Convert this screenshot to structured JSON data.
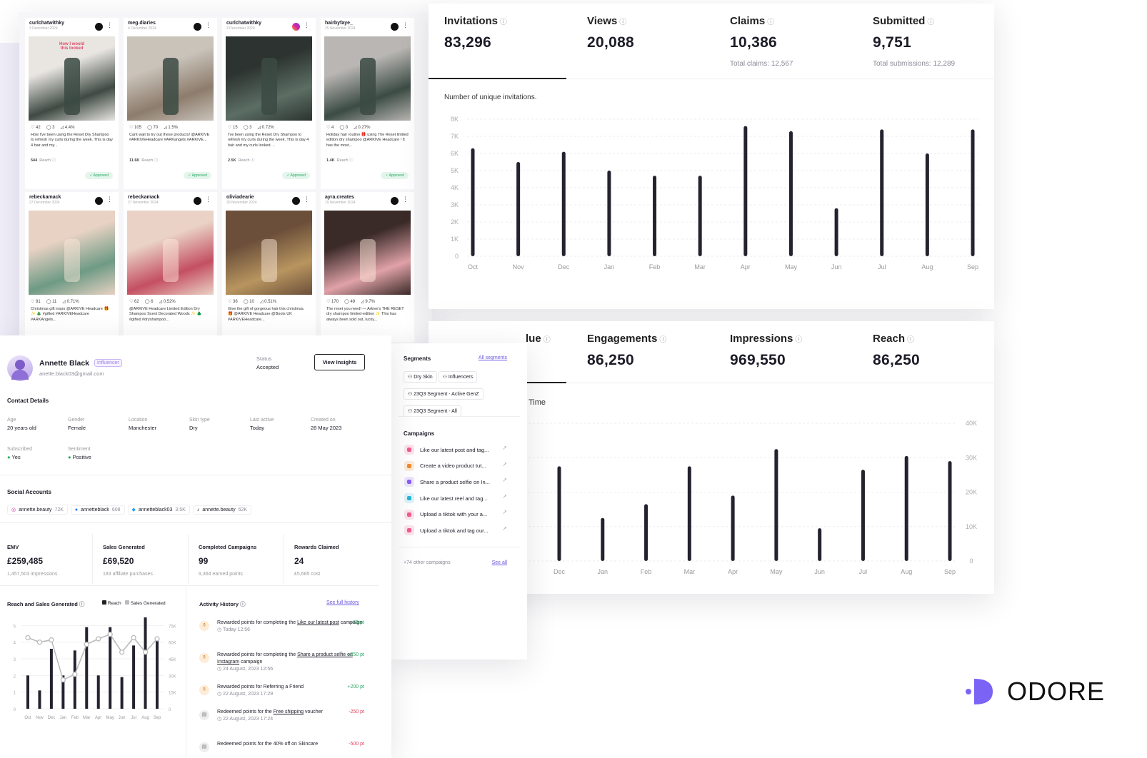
{
  "posts": [
    {
      "user": "curlchatwithky",
      "date": "3 December 2024",
      "icon": "tiktok-icon",
      "likes": "42",
      "comments": "3",
      "er": "4.4%",
      "caption": "How I've been using the Reset Dry Shampoo to refresh my curls during the week. This is day 4 hair and my...",
      "reach": "544",
      "reach_label": "Reach",
      "status": "Approved",
      "overlay": "How I would\n this looked",
      "imgA": "#e9e6e2",
      "imgB": "#3f4a43"
    },
    {
      "user": "meg.diaries",
      "date": "4 December 2024",
      "icon": "tiktok-icon",
      "likes": "105",
      "comments": "70",
      "er": "1.5%",
      "caption": "Cant wait to try out these products! @ARKIVE #ARKIVEHeadcare #ARKangels #ARKIVE...",
      "reach": "11.6K",
      "reach_label": "Reach",
      "status": "Approved",
      "overlay": "",
      "imgA": "#c9c3ba",
      "imgB": "#8d7c6c"
    },
    {
      "user": "curlchatwithky",
      "date": "3 December 2024",
      "icon": "instagram-icon",
      "likes": "15",
      "comments": "3",
      "er": "0.72%",
      "caption": "I've been using the Reset Dry Shampoo to refresh my curls during the week. This is day 4 hair and my curls looked ...",
      "reach": "2.5K",
      "reach_label": "Reach",
      "status": "Approved",
      "overlay": "",
      "imgA": "#2c3330",
      "imgB": "#5c6e64"
    },
    {
      "user": "hairbyfaye_",
      "date": "25 November 2024",
      "icon": "tiktok-icon",
      "likes": "4",
      "comments": "0",
      "er": "0.27%",
      "caption": "Holiday hair routine 🎁 using The Reset limited edition dry shampoo @ARKIVE Headcare ! It has the most...",
      "reach": "1.4K",
      "reach_label": "Reach",
      "status": "Approved",
      "overlay": "",
      "imgA": "#b9b6b3",
      "imgB": "#3c4b45"
    },
    {
      "user": "rebeckamack",
      "date": "27 December 2024",
      "icon": "tiktok-icon",
      "likes": "81",
      "comments": "11",
      "er": "0.71%",
      "caption": "Christmas gift inspo @ARKIVE Headcare 🎁 ✨ 🎄 #gifted #ARKIVEHeadcare #ARKAngels...",
      "reach": "",
      "reach_label": "",
      "status": "",
      "overlay": "",
      "imgA": "#e8d2c4",
      "imgB": "#6e9a84"
    },
    {
      "user": "rebeckamack",
      "date": "27 November 2024",
      "icon": "tiktok-icon",
      "likes": "62",
      "comments": "6",
      "er": "0.52%",
      "caption": "@ARKIVE Headcare Limited Edition Dry Shampoo Scent Decorated Woods ✨ 🌲 #gifted #dryshampoo...",
      "reach": "",
      "reach_label": "",
      "status": "",
      "overlay": "",
      "imgA": "#ead3c6",
      "imgB": "#c44f62"
    },
    {
      "user": "oliviadearie",
      "date": "30 November 2024",
      "icon": "tiktok-icon",
      "likes": "36",
      "comments": "10",
      "er": "0.51%",
      "caption": "Give the gift of gorgeous hair this christmas. 🎁 @ARKIVE Headcare @Boots UK #ARKIVEHeadcare...",
      "reach": "",
      "reach_label": "",
      "status": "",
      "overlay": "",
      "imgA": "#6b4f3a",
      "imgB": "#b8955f"
    },
    {
      "user": "ayra.creates",
      "date": "19 November 2024",
      "icon": "tiktok-icon",
      "likes": "170",
      "comments": "49",
      "er": "9.7%",
      "caption": "The reset you need! — Arkive's THE RESET dry shampoo limited-edition ✨ This has always been sold out, lucky...",
      "reach": "",
      "reach_label": "",
      "status": "",
      "overlay": "",
      "imgA": "#3a2a28",
      "imgB": "#e0a2a8"
    }
  ],
  "top": {
    "stats": [
      {
        "label": "Invitations",
        "value": "83,296",
        "sub": ""
      },
      {
        "label": "Views",
        "value": "20,088",
        "sub": ""
      },
      {
        "label": "Claims",
        "value": "10,386",
        "sub": "Total claims: 12,567"
      },
      {
        "label": "Submitted",
        "value": "9,751",
        "sub": "Total submissions: 12,289"
      }
    ],
    "chart_title": "Number of unique invitations."
  },
  "bottom": {
    "stats": [
      {
        "label": "lue",
        "value": ""
      },
      {
        "label": "Engagements",
        "value": "86,250"
      },
      {
        "label": "Impressions",
        "value": "969,550"
      },
      {
        "label": "Reach",
        "value": "86,250"
      }
    ],
    "chart_title": "Time"
  },
  "profile": {
    "name": "Annette Black",
    "badge": "Influencer",
    "email": "anette.black03@gmail.com",
    "status_label": "Status",
    "status_value": "Accepted",
    "view_insights": "View Insights",
    "contact_title": "Contact Details",
    "details": [
      {
        "k": "Age",
        "v": "20 years old"
      },
      {
        "k": "Gender",
        "v": "Female"
      },
      {
        "k": "Location",
        "v": "Manchester"
      },
      {
        "k": "Skin type",
        "v": "Dry"
      },
      {
        "k": "Last active",
        "v": "Today"
      },
      {
        "k": "Created on",
        "v": "28 May 2023"
      }
    ],
    "subscribed_label": "Subscribed",
    "subscribed_value": "Yes",
    "sentiment_label": "Sentiment",
    "sentiment_value": "Positive",
    "social_title": "Social Accounts",
    "accounts": [
      {
        "icon": "instagram-icon",
        "handle": "annette.beauty",
        "count": "72K"
      },
      {
        "icon": "facebook-icon",
        "handle": "annetteblack",
        "count": "608"
      },
      {
        "icon": "twitter-icon",
        "handle": "annetteblack03",
        "count": "3.5K"
      },
      {
        "icon": "tiktok-icon",
        "handle": "annette.beauty",
        "count": "62K"
      }
    ],
    "metrics": [
      {
        "k": "EMV",
        "v": "£259,485",
        "s": "1,457,503 impressions"
      },
      {
        "k": "Sales Generated",
        "v": "£69,520",
        "s": "183 affiliate purchases"
      },
      {
        "k": "Completed Campaigns",
        "v": "99",
        "s": "9,364 earned points"
      },
      {
        "k": "Rewards Claimed",
        "v": "24",
        "s": "£5,685 cost"
      }
    ],
    "reach_sales_title": "Reach and Sales Generated",
    "legend_reach": "Reach",
    "legend_sales": "Sales Generated",
    "activity_title": "Activity History",
    "see_full_history": "See full history",
    "activities": [
      {
        "text": "Rewarded points for completing the",
        "link": "Like our latest post",
        "tail": "campaign",
        "time": "Today 12:56",
        "pts": "+50 pt",
        "neg": false
      },
      {
        "text": "Rewarded points for completing the",
        "link": "Share a product selfie on Instagram",
        "tail": "campaign",
        "time": "24 August, 2023 12:56",
        "pts": "+250 pt",
        "neg": false
      },
      {
        "text": "Rewarded points for Referring a Friend",
        "link": "",
        "tail": "",
        "time": "22 August, 2023 17:29",
        "pts": "+200 pt",
        "neg": false
      },
      {
        "text": "Redeemed points for the",
        "link": "Free shipping",
        "tail": "voucher",
        "time": "22 August, 2023 17:24",
        "pts": "-250 pt",
        "neg": true
      },
      {
        "text": "Redeemed points for the 40% off on Skincare",
        "link": "",
        "tail": "",
        "time": "",
        "pts": "-500 pt",
        "neg": true
      }
    ]
  },
  "segments": {
    "title": "Segments",
    "all_link": "All segments",
    "chips": [
      "Dry Skin",
      "Influencers",
      "23Q3 Segment - Active GenZ",
      "23Q3 Segment - All"
    ],
    "campaigns_title": "Campaigns",
    "campaigns": [
      {
        "label": "Like our latest post and tag...",
        "color": "#f25c8a",
        "bg": "#fde4ec"
      },
      {
        "label": "Create a video product tut...",
        "color": "#f08a2c",
        "bg": "#fdebd9"
      },
      {
        "label": "Share a product selfie on In...",
        "color": "#8b5cf6",
        "bg": "#ece5fd"
      },
      {
        "label": "Like our latest reel and tag...",
        "color": "#29b6d8",
        "bg": "#dff3f9"
      },
      {
        "label": "Upload a tiktok with your a...",
        "color": "#f25c8a",
        "bg": "#fde4ec"
      },
      {
        "label": "Upload a tiktok and tag our...",
        "color": "#f25c8a",
        "bg": "#fde4ec"
      }
    ],
    "more": "+74 other campaigns",
    "see_all": "See all"
  },
  "logo": {
    "text": "ODORE",
    "color": "#7b63f5"
  },
  "chart_data": [
    {
      "type": "bar",
      "title": "Number of unique invitations.",
      "categories": [
        "Oct",
        "Nov",
        "Dec",
        "Jan",
        "Feb",
        "Mar",
        "Apr",
        "May",
        "Jun",
        "Jul",
        "Aug",
        "Sep"
      ],
      "values": [
        6300,
        5500,
        6100,
        5000,
        4700,
        4700,
        7600,
        7300,
        2800,
        7400,
        6000,
        7400
      ],
      "ylim": [
        0,
        8000
      ],
      "yticks": [
        "0",
        "1K",
        "2K",
        "3K",
        "4K",
        "5K",
        "6K",
        "7K",
        "8K"
      ]
    },
    {
      "type": "bar",
      "title": "Time",
      "categories": [
        "Dec",
        "Jan",
        "Feb",
        "Mar",
        "Apr",
        "May",
        "Jun",
        "Jul",
        "Aug",
        "Sep"
      ],
      "values": [
        27500,
        12500,
        16500,
        27500,
        19000,
        32500,
        9500,
        26500,
        30500,
        29000
      ],
      "ylim": [
        0,
        40000
      ],
      "yticks": [
        "0",
        "10K",
        "20K",
        "30K",
        "40K"
      ]
    },
    {
      "type": "bar",
      "title": "Reach and Sales Generated",
      "categories": [
        "Oct",
        "Nov",
        "Dec",
        "Jan",
        "Feb",
        "Mar",
        "Apr",
        "May",
        "Jun",
        "Jul",
        "Aug",
        "Sep"
      ],
      "series": [
        {
          "name": "Reach",
          "values": [
            2.0,
            1.1,
            3.6,
            2.0,
            3.5,
            4.9,
            2.0,
            4.9,
            1.9,
            3.8,
            5.9,
            4.3
          ]
        },
        {
          "name": "Sales Generated",
          "values": [
            64000,
            60000,
            62000,
            26000,
            31000,
            58000,
            63000,
            67000,
            51000,
            64000,
            51000,
            63000
          ]
        }
      ],
      "ylim_left": [
        0,
        6
      ],
      "ylim_right": [
        0,
        90000
      ],
      "yticks_left": [
        "0",
        "1",
        "2",
        "3",
        "4",
        "5",
        "6"
      ],
      "yticks_right": [
        "0",
        "15K",
        "30K",
        "45K",
        "60K",
        "75K",
        "90K"
      ]
    }
  ]
}
